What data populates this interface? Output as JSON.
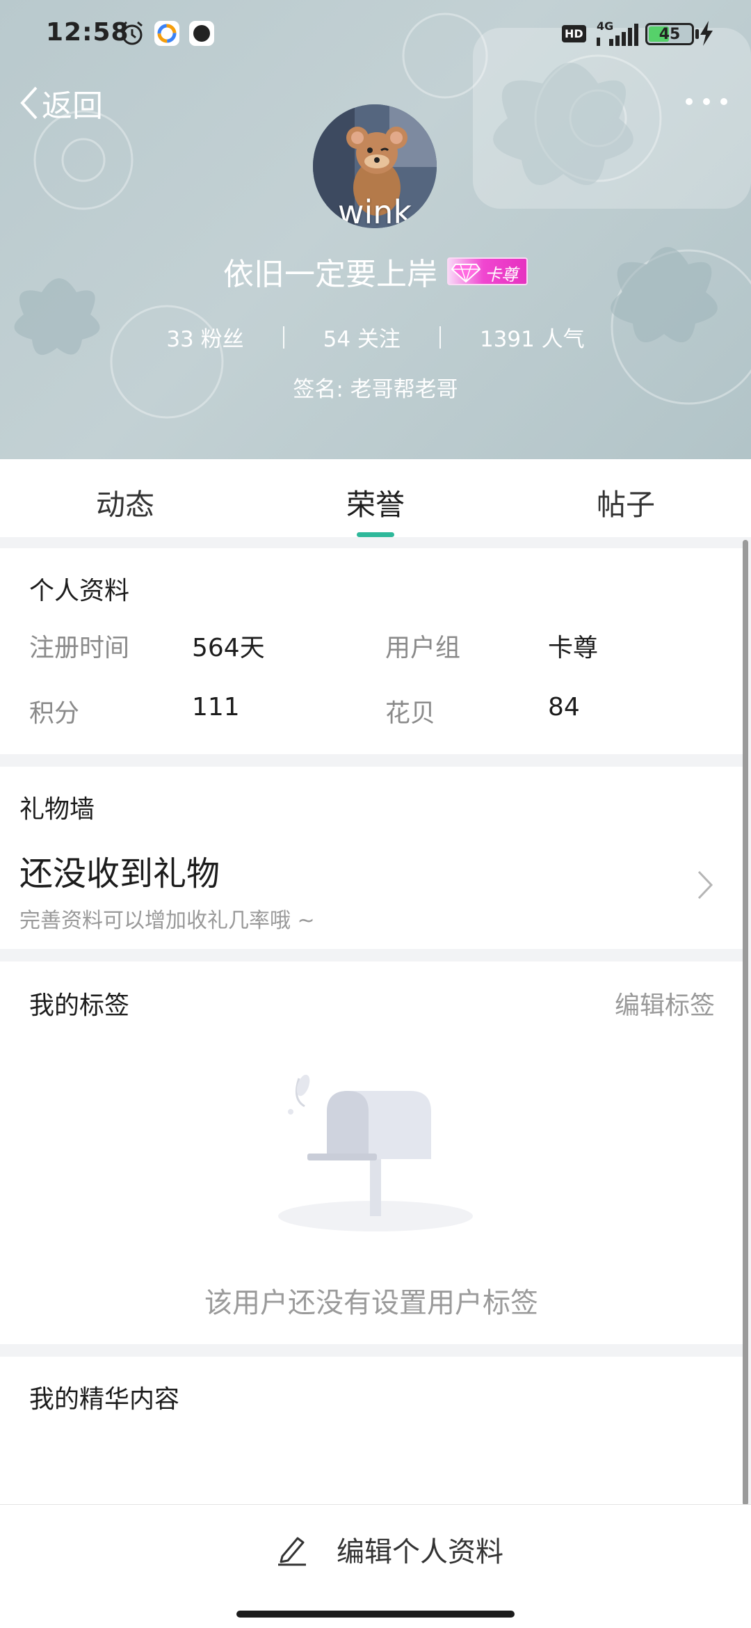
{
  "status_bar": {
    "time": "12:58",
    "hd_badge": "HD",
    "network": "4G",
    "battery_level": "45",
    "icons": [
      "alarm-icon",
      "app-store-icon",
      "music-app-icon",
      "signal-icon",
      "battery-icon",
      "charging-icon"
    ]
  },
  "header": {
    "back_label": "返回",
    "avatar_text": "wink",
    "username": "依旧一定要上岸",
    "vip_badge_label": "卡尊",
    "stats": [
      {
        "text": "33 粉丝"
      },
      {
        "text": "54 关注"
      },
      {
        "text": "1391 人气"
      }
    ],
    "signature": "签名: 老哥帮老哥"
  },
  "tabs": [
    {
      "label": "动态"
    },
    {
      "label": "荣誉"
    },
    {
      "label": "帖子"
    }
  ],
  "active_tab": "荣誉",
  "profile": {
    "title": "个人资料",
    "fields": [
      {
        "label": "注册时间",
        "value": "564天"
      },
      {
        "label": "用户组",
        "value": "卡尊"
      },
      {
        "label": "积分",
        "value": "111"
      },
      {
        "label": "花贝",
        "value": "84"
      }
    ]
  },
  "gift_wall": {
    "title": "礼物墙",
    "main_text": "还没收到礼物",
    "sub_text": "完善资料可以增加收礼几率哦 ~"
  },
  "tags": {
    "title": "我的标签",
    "edit_label": "编辑标签",
    "empty_text": "该用户还没有设置用户标签"
  },
  "featured": {
    "title": "我的精华内容"
  },
  "bottom": {
    "edit_profile_label": "编辑个人资料"
  },
  "colors": {
    "accent": "#2eb89a",
    "header_bg": "#b9c9cd",
    "vip_pink": "#e632c0"
  }
}
